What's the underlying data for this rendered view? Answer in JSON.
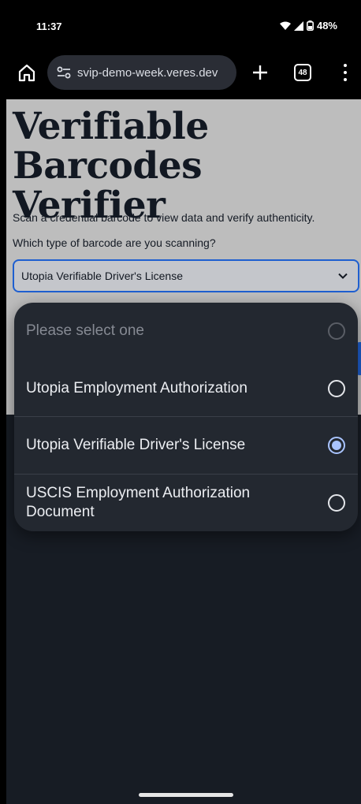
{
  "status_bar": {
    "time": "11:37",
    "battery": "48%"
  },
  "browser": {
    "url": "svip-demo-week.veres.dev",
    "tab_count": "48",
    "icons": [
      "home-icon",
      "tune-icon",
      "plus-icon",
      "tabs-icon",
      "more-vert-icon"
    ]
  },
  "page": {
    "title": "Verifiable Barcodes Verifier",
    "intro": "Scan a credential barcode to view data and verify authenticity.",
    "question": "Which type of barcode are you scanning?",
    "select_value": "Utopia Verifiable Driver's License"
  },
  "dropdown": {
    "options": [
      {
        "label": "Please select one",
        "state": "disabled"
      },
      {
        "label": "Utopia Employment Authorization",
        "state": "unchecked"
      },
      {
        "label": "Utopia Verifiable Driver's License",
        "state": "checked"
      },
      {
        "label": "USCIS Employment Authorization Document",
        "state": "unchecked"
      }
    ]
  },
  "colors": {
    "accent": "#a9c4ff",
    "select_border": "#1e5fd0",
    "dialog_bg": "#232830"
  }
}
